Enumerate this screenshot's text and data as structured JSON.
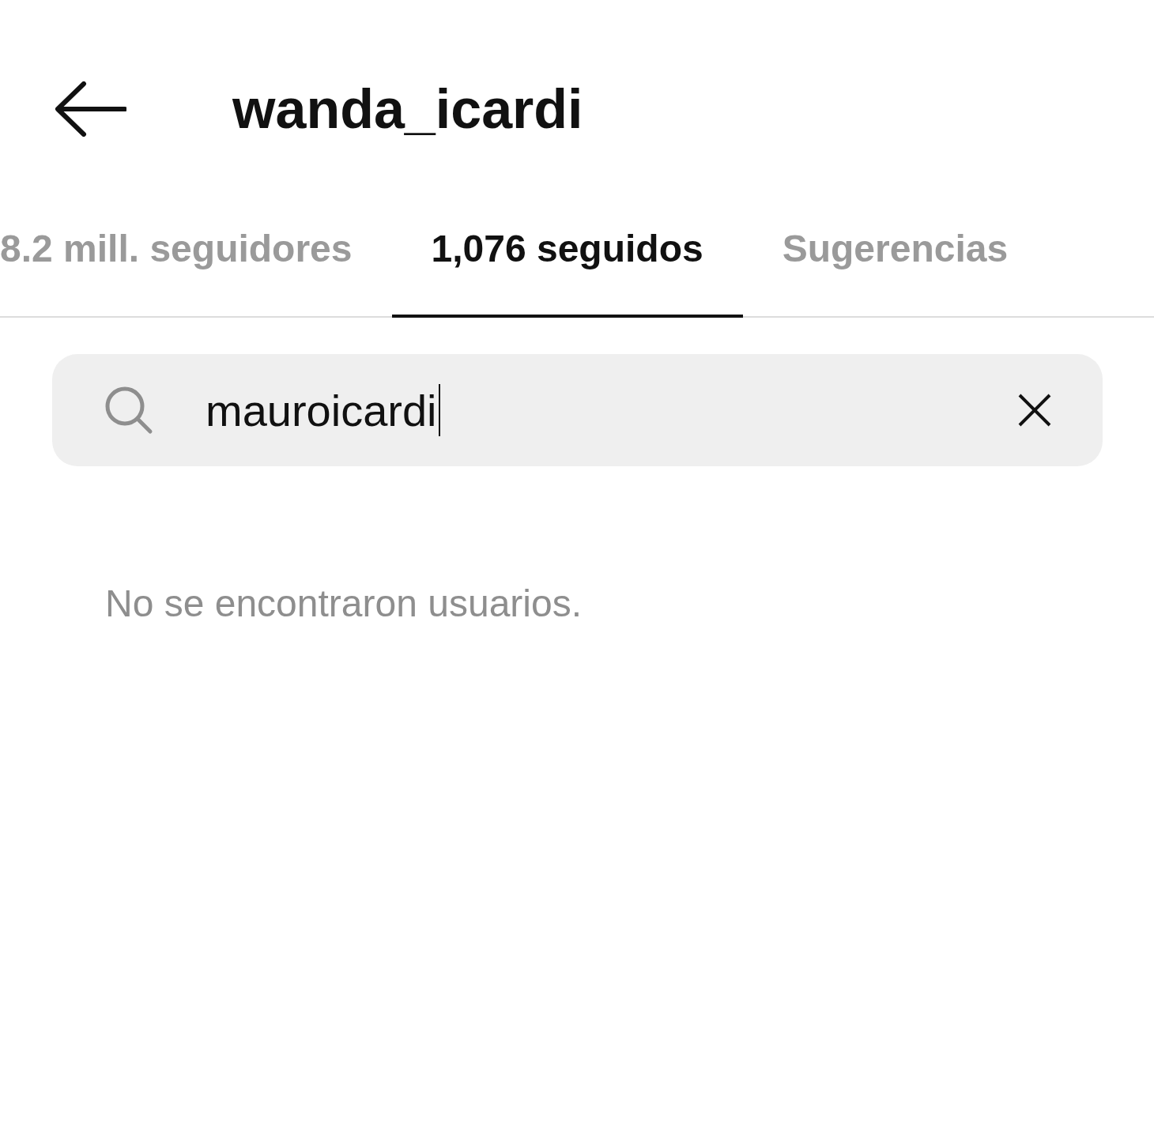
{
  "header": {
    "title": "wanda_icardi"
  },
  "tabs": [
    {
      "label": "8.2 mill. seguidores",
      "selected": false
    },
    {
      "label": "1,076 seguidos",
      "selected": true
    },
    {
      "label": "Sugerencias",
      "selected": false
    }
  ],
  "search": {
    "value": "mauroicardi",
    "focused": true
  },
  "empty_message": "No se encontraron usuarios."
}
